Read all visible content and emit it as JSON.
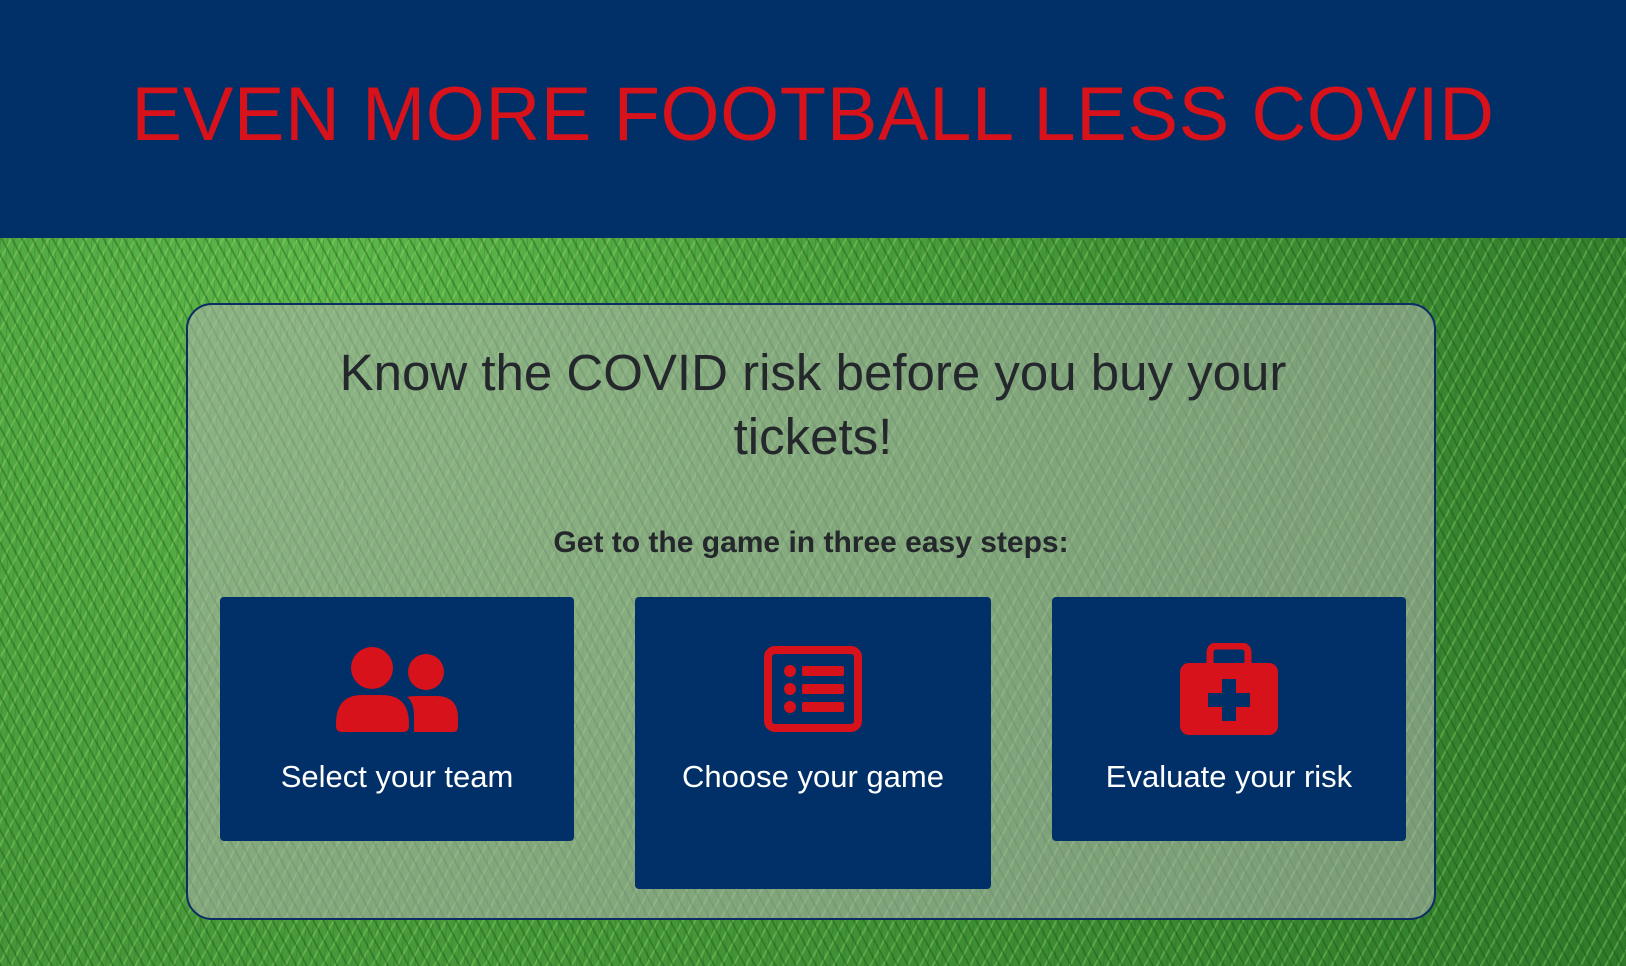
{
  "header": {
    "title": "EVEN MORE FOOTBALL LESS COVID"
  },
  "main": {
    "headline": "Know the COVID risk before you buy your tickets!",
    "subheadline": "Get to the game in three easy steps:",
    "steps": [
      {
        "label": "Select your team",
        "icon": "users-icon"
      },
      {
        "label": "Choose your game",
        "icon": "list-icon"
      },
      {
        "label": "Evaluate your risk",
        "icon": "medkit-icon"
      }
    ]
  },
  "colors": {
    "navy": "#003067",
    "accent_red": "#d7121b",
    "text_dark": "#24272b",
    "text_white": "#ffffff"
  }
}
